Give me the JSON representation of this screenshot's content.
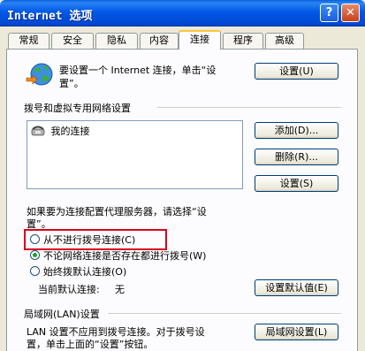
{
  "window": {
    "title": "Internet 选项",
    "help_label": "?",
    "close_label": "✕"
  },
  "tabs": [
    {
      "label": "常规"
    },
    {
      "label": "安全"
    },
    {
      "label": "隐私"
    },
    {
      "label": "内容"
    },
    {
      "label": "连接"
    },
    {
      "label": "程序"
    },
    {
      "label": "高级"
    }
  ],
  "active_tab": "连接",
  "setup": {
    "text_line1": "要设置一个 Internet 连接，单击“设",
    "text_line2": "置”。",
    "button": "设置(U)",
    "icon": "globe-network-icon"
  },
  "dialup": {
    "heading": "拨号和虚拟专用网络设置",
    "connections": [
      {
        "label": "我的连接",
        "icon": "dialup-phone-icon"
      }
    ],
    "add_button": "添加(D)...",
    "remove_button": "删除(R)...",
    "settings_button": "设置(S)",
    "proxy_note_line1": "如果要为连接配置代理服务器，请选择“设",
    "proxy_note_line2": "置”。",
    "options": [
      {
        "label": "从不进行拨号连接(C)",
        "checked": false
      },
      {
        "label": "不论网络连接是否存在都进行拨号(W)",
        "checked": true
      },
      {
        "label": "始终拨默认连接(O)",
        "checked": false
      }
    ],
    "current_default_label": "当前默认连接:",
    "current_default_value": "无",
    "set_default_button": "设置默认值(E)"
  },
  "lan": {
    "heading": "局域网(LAN)设置",
    "note_line1": "LAN 设置不应用到拨号连接。对于拨号设",
    "note_line2": "置，单击上面的“设置”按钮。",
    "button": "局域网设置(L)"
  },
  "colors": {
    "title_bar": "#0054e3",
    "dialog_bg": "#ece9d8",
    "highlight_box": "#d9001b",
    "radio_dot": "#21a121"
  }
}
